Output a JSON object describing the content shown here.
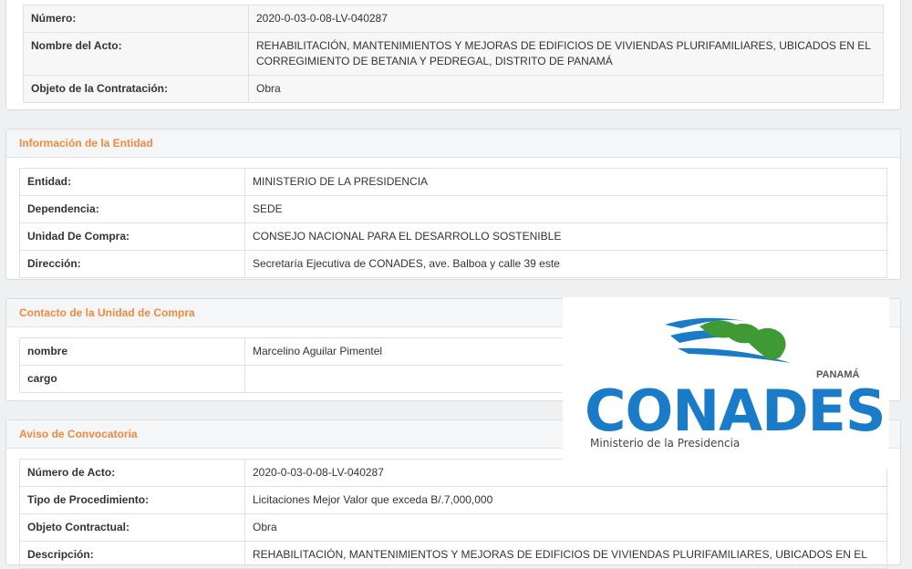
{
  "acto": {
    "rows": [
      {
        "label": "Número:",
        "value": "2020-0-03-0-08-LV-040287"
      },
      {
        "label": "Nombre del Acto:",
        "value": "REHABILITACIÓN, MANTENIMIENTOS Y MEJORAS DE EDIFICIOS DE VIVIENDAS PLURIFAMILIARES, UBICADOS EN EL CORREGIMIENTO DE BETANIA Y PEDREGAL, DISTRITO DE PANAMÁ"
      },
      {
        "label": "Objeto de la Contratación:",
        "value": "Obra"
      }
    ]
  },
  "entidad": {
    "title": "Información de la Entidad",
    "rows": [
      {
        "label": "Entidad:",
        "value": "MINISTERIO DE LA PRESIDENCIA"
      },
      {
        "label": "Dependencia:",
        "value": "SEDE"
      },
      {
        "label": "Unidad De Compra:",
        "value": "CONSEJO NACIONAL PARA EL DESARROLLO SOSTENIBLE"
      },
      {
        "label": "Dirección:",
        "value": "Secretaría Ejecutiva de CONADES, ave. Balboa y calle 39 este"
      }
    ]
  },
  "contacto": {
    "title": "Contacto de la Unidad de Compra",
    "rows": [
      {
        "label": "nombre",
        "value": "Marcelino Aguilar Pimentel"
      },
      {
        "label": "cargo",
        "value": ""
      }
    ]
  },
  "aviso": {
    "title": "Aviso de Convocatoria",
    "rows": [
      {
        "label": "Número de Acto:",
        "value": "2020-0-03-0-08-LV-040287"
      },
      {
        "label": "Tipo de Procedimiento:",
        "value": "Licitaciones Mejor Valor que exceda B/.7,000,000"
      },
      {
        "label": "Objeto Contractual:",
        "value": "Obra"
      },
      {
        "label": "Descripción:",
        "value": "REHABILITACIÓN, MANTENIMIENTOS Y MEJORAS DE EDIFICIOS DE VIVIENDAS PLURIFAMILIARES, UBICADOS EN EL"
      }
    ]
  },
  "logo": {
    "country": "PANAMÁ",
    "name": "CONADES",
    "subtitle": "Ministerio de la Presidencia",
    "colors": {
      "blue": "#1a7bc9",
      "green": "#3f9a35"
    }
  },
  "colors": {
    "accent": "#f08a3c",
    "border": "#dfe1e3"
  }
}
